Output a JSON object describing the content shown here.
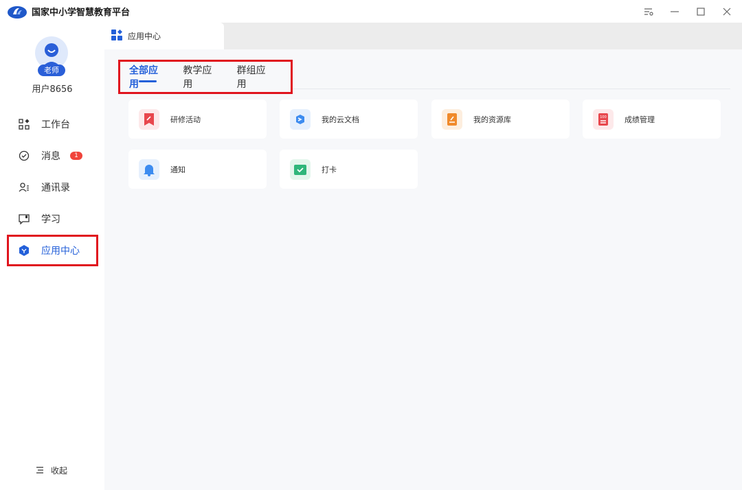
{
  "app": {
    "title": "国家中小学智慧教育平台",
    "brand_color": "#2460d9"
  },
  "window_controls": {
    "icons": [
      "settings-filter-icon",
      "minimize-icon",
      "maximize-icon",
      "close-icon"
    ]
  },
  "user": {
    "role": "老师",
    "name": "用户8656"
  },
  "sidebar": {
    "items": [
      {
        "label": "工作台",
        "icon": "workbench-icon"
      },
      {
        "label": "消息",
        "icon": "message-icon",
        "badge": "1"
      },
      {
        "label": "通讯录",
        "icon": "contacts-icon"
      },
      {
        "label": "学习",
        "icon": "study-icon"
      },
      {
        "label": "应用中心",
        "icon": "app-center-icon",
        "active": true
      }
    ],
    "collapse_label": "收起"
  },
  "main": {
    "page_tab": "应用中心",
    "category_tabs": [
      {
        "label": "全部应用",
        "active": true
      },
      {
        "label": "教学应用"
      },
      {
        "label": "群组应用"
      }
    ],
    "apps": [
      {
        "label": "研修活动",
        "icon": "bookmark-icon",
        "color": "#e8474d"
      },
      {
        "label": "我的云文档",
        "icon": "cloud-doc-icon",
        "color": "#3d8cf0"
      },
      {
        "label": "我的资源库",
        "icon": "resource-icon",
        "color": "#f08a2b"
      },
      {
        "label": "成绩管理",
        "icon": "score-icon",
        "color": "#e8474d"
      },
      {
        "label": "通知",
        "icon": "bell-icon",
        "color": "#3d8cf0"
      },
      {
        "label": "打卡",
        "icon": "check-in-icon",
        "color": "#2fb67a"
      }
    ]
  }
}
